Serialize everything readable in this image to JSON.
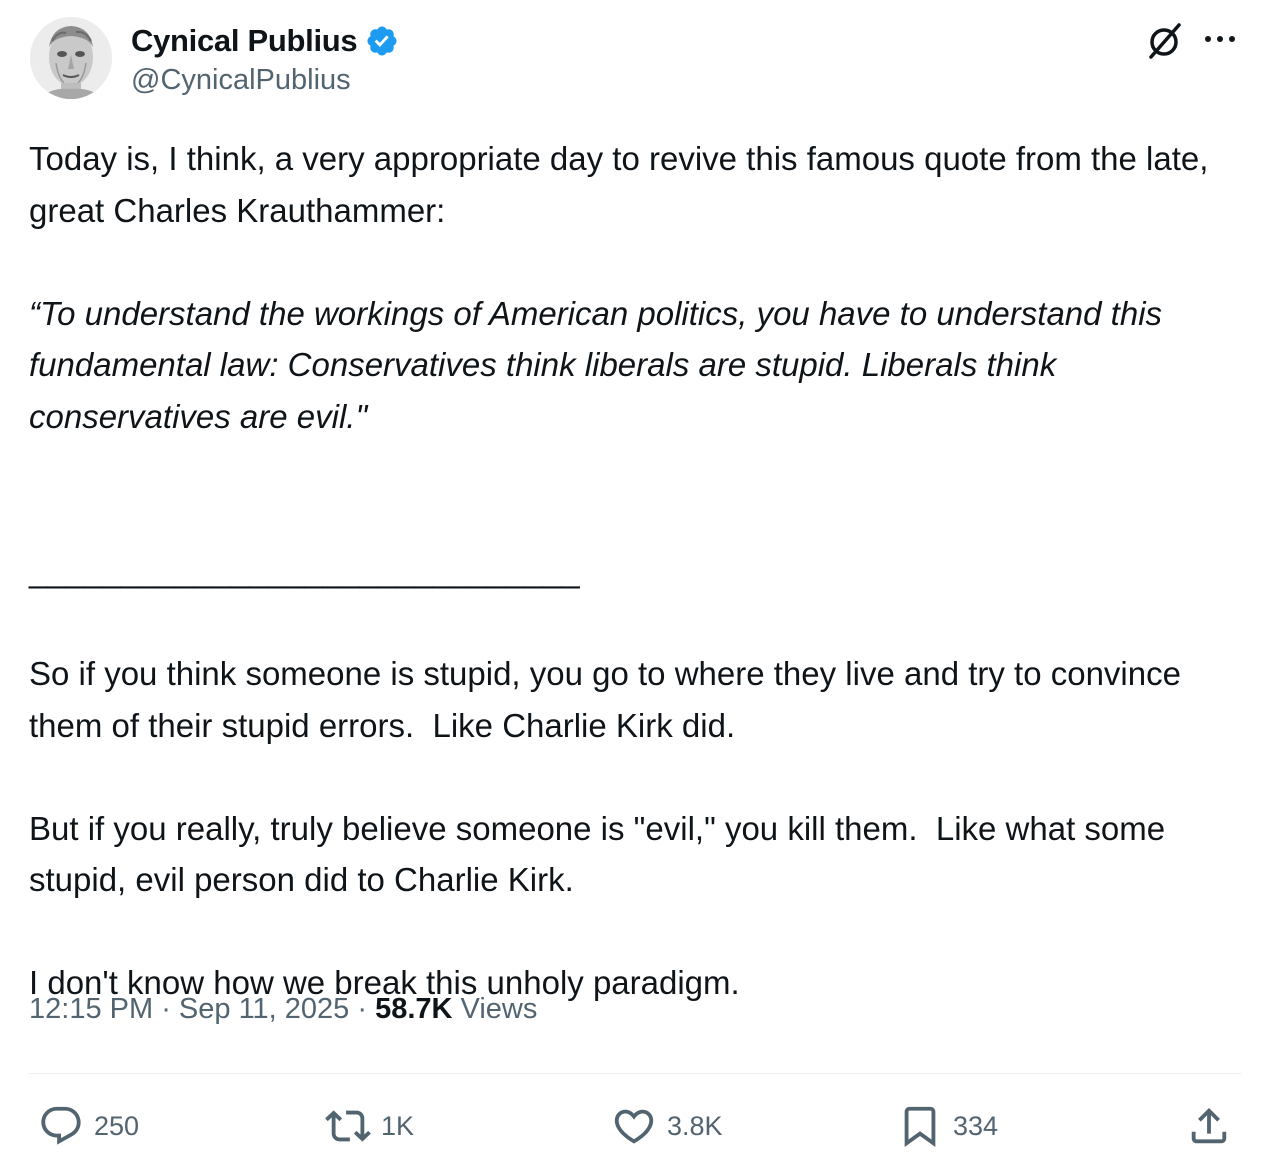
{
  "author": {
    "display_name": "Cynical Publius",
    "handle": "@CynicalPublius",
    "verified_color": "#1d9bf0"
  },
  "header_icons": {
    "grok": "grok-icon",
    "more": "more-icon"
  },
  "tweet": {
    "paragraphs": {
      "p1": "Today is, I think, a very appropriate day to revive this famous quote from the late, great Charles Krauthammer:",
      "quote": "“To understand the workings of American politics, you have to understand this fundamental law: Conservatives think liberals are stupid. Liberals think conservatives are evil.\"",
      "separator": "______________________________",
      "p2": "So if you think someone is stupid, you go to where they live and try to convince them of their stupid errors.  Like Charlie Kirk did.",
      "p3": "But if you really, truly believe someone is \"evil,\" you kill them.  Like what some stupid, evil person did to Charlie Kirk.",
      "p4": "I don't know how we break this unholy paradigm."
    },
    "time": "12:15 PM",
    "dot1": " · ",
    "date": "Sep 11, 2025",
    "dot2": " · ",
    "views_count": "58.7K",
    "views_label": " Views"
  },
  "actions": {
    "replies": "250",
    "reposts": "1K",
    "likes": "3.8K",
    "bookmarks": "334"
  },
  "colors": {
    "text": "#0f1419",
    "secondary": "#536471",
    "divider": "#eff3f4"
  }
}
